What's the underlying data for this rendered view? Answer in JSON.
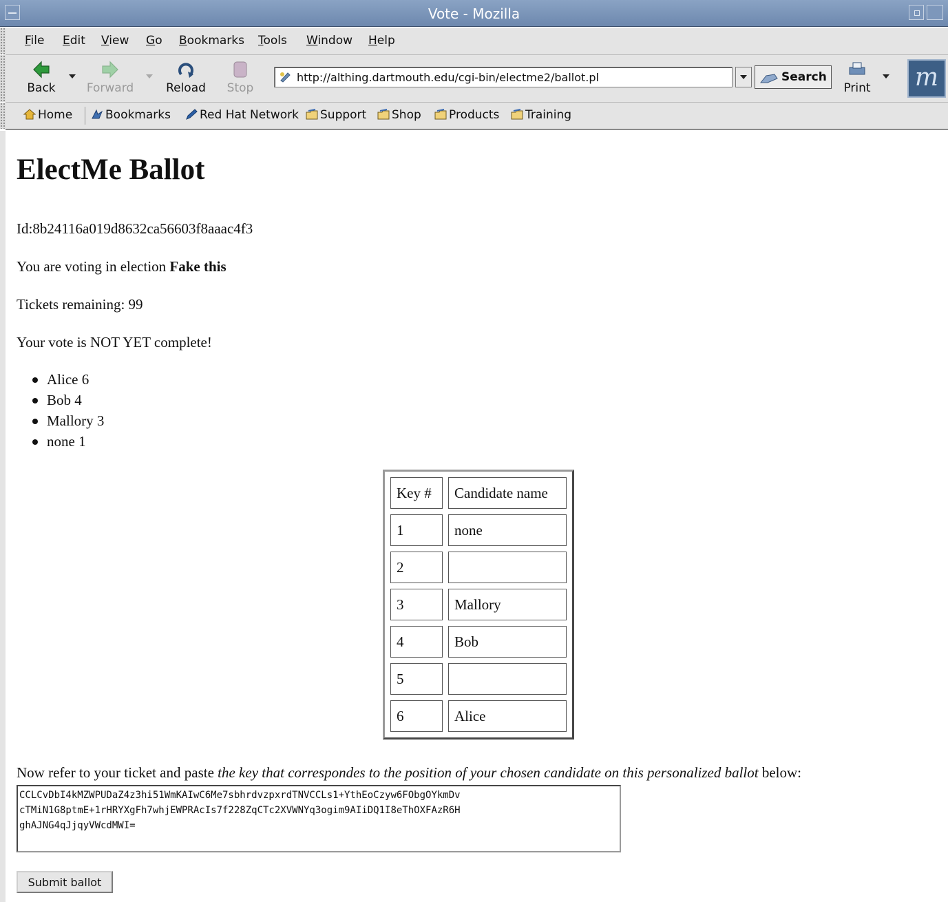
{
  "window": {
    "title": "Vote - Mozilla"
  },
  "menubar": {
    "items": [
      {
        "accel": "F",
        "rest": "ile"
      },
      {
        "accel": "E",
        "rest": "dit"
      },
      {
        "accel": "V",
        "rest": "iew"
      },
      {
        "accel": "G",
        "rest": "o"
      },
      {
        "accel": "B",
        "rest": "ookmarks"
      },
      {
        "accel": "T",
        "rest": "ools"
      },
      {
        "accel": "W",
        "rest": "indow"
      },
      {
        "accel": "H",
        "rest": "elp"
      }
    ]
  },
  "toolbar": {
    "back": "Back",
    "forward": "Forward",
    "reload": "Reload",
    "stop": "Stop",
    "url": "http://althing.dartmouth.edu/cgi-bin/electme2/ballot.pl",
    "search": "Search",
    "print": "Print"
  },
  "personal_toolbar": {
    "home": "Home",
    "bookmarks": "Bookmarks",
    "red_hat_network": "Red Hat Network",
    "support": "Support",
    "shop": "Shop",
    "products": "Products",
    "training": "Training"
  },
  "page": {
    "title": "ElectMe Ballot",
    "id_line": "Id:8b24116a019d8632ca56603f8aaac4f3",
    "election_prefix": "You are voting in election ",
    "election_name": "Fake this",
    "tickets_remaining": "Tickets remaining: 99",
    "vote_status": "Your vote is NOT YET complete!",
    "tally": [
      "Alice 6",
      "Bob 4",
      "Mallory 3",
      "none 1"
    ],
    "table": {
      "headers": [
        "Key #",
        "Candidate name"
      ],
      "rows": [
        [
          "1",
          "none"
        ],
        [
          "2",
          ""
        ],
        [
          "3",
          "Mallory"
        ],
        [
          "4",
          "Bob"
        ],
        [
          "5",
          ""
        ],
        [
          "6",
          "Alice"
        ]
      ]
    },
    "instruction_prefix": "Now refer to your ticket and paste ",
    "instruction_emphasis": "the key that correspondes to the position of your chosen candidate on this personalized ballot",
    "instruction_suffix": " below:",
    "key_value": "CCLCvDbI4kMZWPUDaZ4z3hi51WmKAIwC6Me7sbhrdvzpxrdTNVCCLs1+YthEoCzyw6FObgOYkmDv\ncTMiN1G8ptmE+1rHRYXgFh7whjEWPRAcIs7f228ZqCTc2XVWNYq3ogim9AIiDQ1I8eThOXFAzR6H\nghAJNG4qJjqyVWcdMWI=",
    "submit_label": "Submit ballot"
  }
}
